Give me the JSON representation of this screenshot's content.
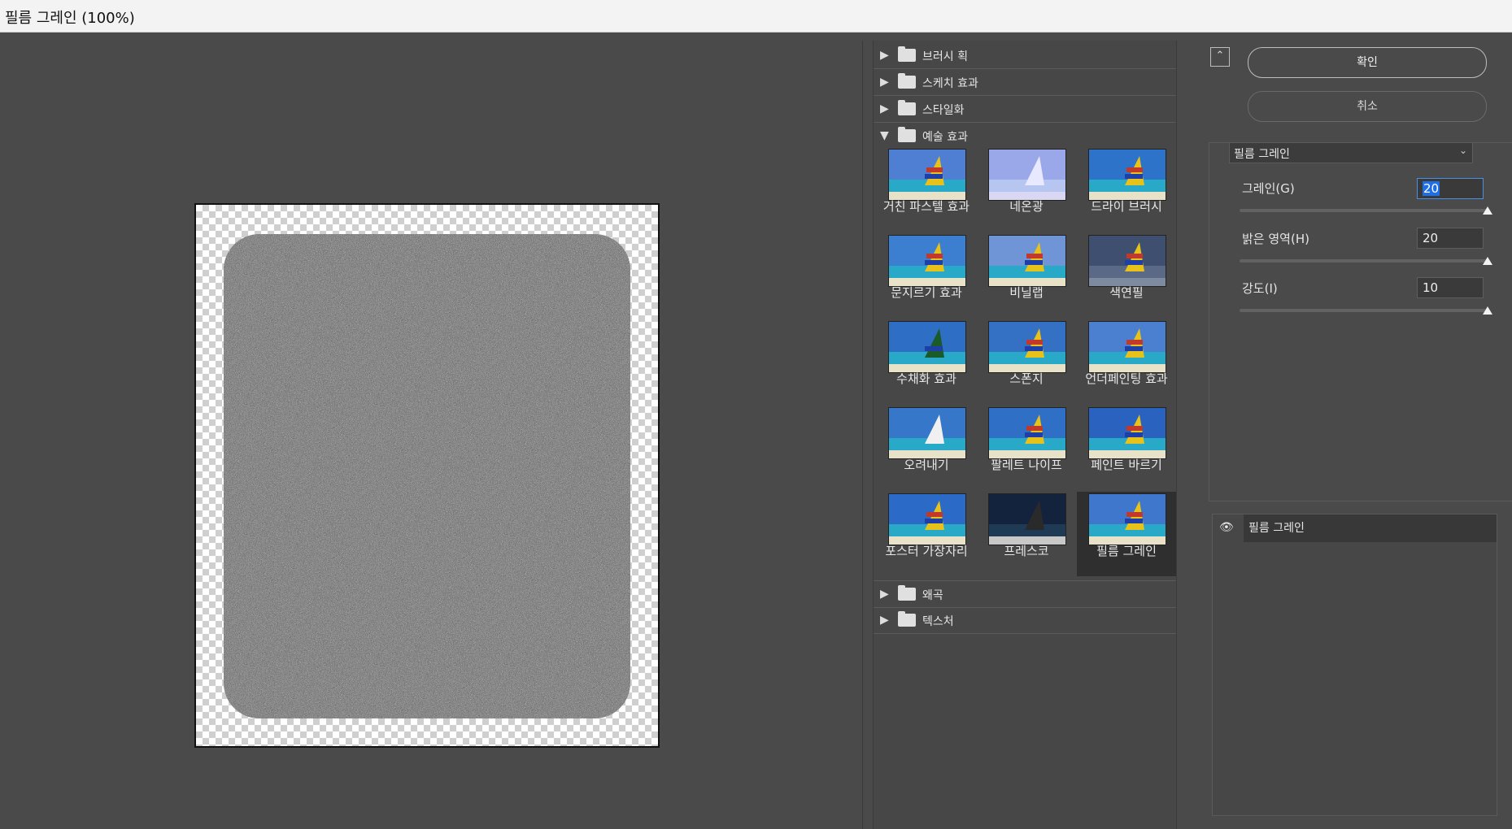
{
  "window": {
    "title": "필름 그레인 (100%)"
  },
  "filters": {
    "categories": [
      {
        "label": "브러시 획",
        "expanded": false
      },
      {
        "label": "스케치 효과",
        "expanded": false
      },
      {
        "label": "스타일화",
        "expanded": false
      },
      {
        "label": "예술 효과",
        "expanded": true
      },
      {
        "label": "왜곡",
        "expanded": false
      },
      {
        "label": "텍스처",
        "expanded": false
      }
    ],
    "artistic_items": [
      {
        "label": "거친 파스텔 효과"
      },
      {
        "label": "네온광"
      },
      {
        "label": "드라이 브러시"
      },
      {
        "label": "문지르기 효과"
      },
      {
        "label": "비닐랩"
      },
      {
        "label": "색연필"
      },
      {
        "label": "수채화 효과"
      },
      {
        "label": "스폰지"
      },
      {
        "label": "언더페인팅 효과"
      },
      {
        "label": "오려내기"
      },
      {
        "label": "팔레트 나이프"
      },
      {
        "label": "페인트 바르기"
      },
      {
        "label": "포스터 가장자리"
      },
      {
        "label": "프레스코"
      },
      {
        "label": "필름 그레인",
        "selected": true
      }
    ]
  },
  "actions": {
    "ok_label": "확인",
    "cancel_label": "취소"
  },
  "params": {
    "selected_filter": "필름 그레인",
    "grain_label": "그레인(G)",
    "grain_value": "20",
    "grain_fraction": 1.0,
    "highlight_label": "밝은 영역(H)",
    "highlight_value": "20",
    "highlight_fraction": 1.0,
    "intensity_label": "강도(I)",
    "intensity_value": "10",
    "intensity_fraction": 1.0
  },
  "layers": {
    "items": [
      {
        "name": "필름 그레인",
        "visible": true
      }
    ]
  },
  "icons": {
    "eye": "eye-icon",
    "folder": "folder-icon",
    "expand": "triangle-right-icon",
    "collapse": "triangle-down-icon",
    "panel-toggle": "collapse-up-icon"
  }
}
